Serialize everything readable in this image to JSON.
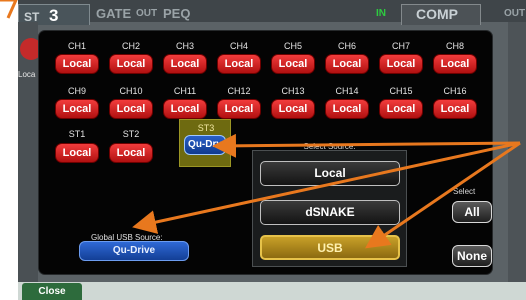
{
  "topbar": {
    "st_label": "ST",
    "channel_number": "3",
    "gate_label": "GATE",
    "gate_out": "OUT",
    "peq_label": "PEQ",
    "in_label": "IN",
    "comp_label": "COMP",
    "comp_out": "OUT",
    "side_text": "Loca"
  },
  "modal": {
    "channels": [
      {
        "label": "CH1",
        "button": "Local"
      },
      {
        "label": "CH2",
        "button": "Local"
      },
      {
        "label": "CH3",
        "button": "Local"
      },
      {
        "label": "CH4",
        "button": "Local"
      },
      {
        "label": "CH5",
        "button": "Local"
      },
      {
        "label": "CH6",
        "button": "Local"
      },
      {
        "label": "CH7",
        "button": "Local"
      },
      {
        "label": "CH8",
        "button": "Local"
      },
      {
        "label": "CH9",
        "button": "Local"
      },
      {
        "label": "CH10",
        "button": "Local"
      },
      {
        "label": "CH11",
        "button": "Local"
      },
      {
        "label": "CH12",
        "button": "Local"
      },
      {
        "label": "CH13",
        "button": "Local"
      },
      {
        "label": "CH14",
        "button": "Local"
      },
      {
        "label": "CH15",
        "button": "Local"
      },
      {
        "label": "CH16",
        "button": "Local"
      },
      {
        "label": "ST1",
        "button": "Local"
      },
      {
        "label": "ST2",
        "button": "Local"
      }
    ],
    "st3": {
      "label": "ST3",
      "button": "Qu-Drv"
    },
    "select_source": {
      "title": "Select Source:",
      "options": [
        "Local",
        "dSNAKE",
        "USB"
      ],
      "selected": "USB"
    },
    "select_label": "Select",
    "all_button": "All",
    "none_button": "None",
    "global_usb": {
      "label": "Global USB Source:",
      "button": "Qu-Drive"
    }
  },
  "bottom": {
    "close_label": "Close"
  },
  "colors": {
    "accent_arrow": "#e8781e",
    "local_red": "#d42020",
    "usb_gold": "#b8901e",
    "qu_blue": "#1f4fb4"
  }
}
